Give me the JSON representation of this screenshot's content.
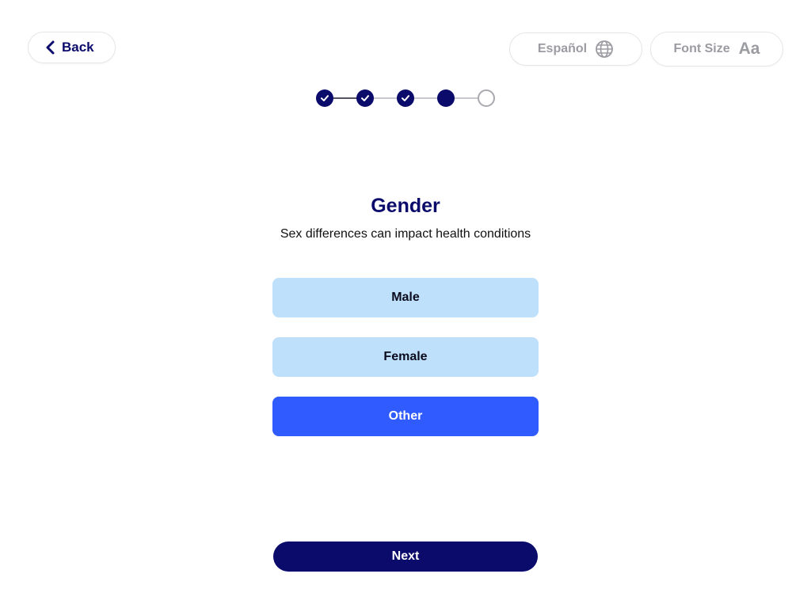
{
  "header": {
    "back_label": "Back",
    "language_label": "Español",
    "font_size_label": "Font Size",
    "font_size_glyph": "Aa"
  },
  "progress": {
    "total_steps": 5,
    "current_step": 4,
    "steps": [
      "done",
      "done",
      "done",
      "current",
      "todo"
    ]
  },
  "question": {
    "title": "Gender",
    "subtitle": "Sex differences can impact health conditions"
  },
  "options": [
    {
      "label": "Male",
      "selected": false
    },
    {
      "label": "Female",
      "selected": false
    },
    {
      "label": "Other",
      "selected": true
    }
  ],
  "footer": {
    "next_label": "Next"
  },
  "colors": {
    "navy": "#0b0b6b",
    "option_unselected": "#bfe0fb",
    "option_selected": "#2f5bff",
    "muted": "#9b9ba2"
  },
  "icons": {
    "back": "chevron-left-icon",
    "language": "globe-icon",
    "step_done": "check-icon"
  }
}
